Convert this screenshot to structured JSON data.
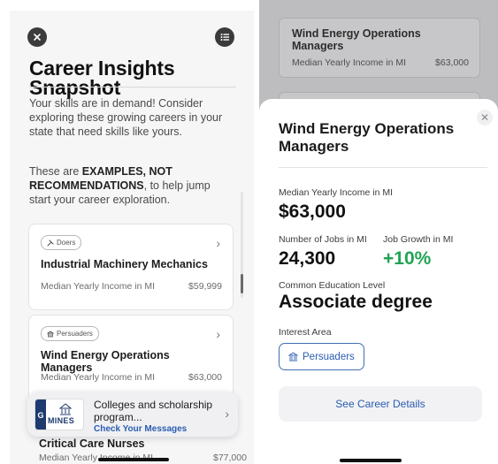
{
  "left": {
    "title_line1": "Career Insights",
    "title_line2": "Snapshot",
    "intro": "Your skills are in demand! Consider exploring these growing careers in your state that need skills like yours.",
    "disclaimer_pre": "These are ",
    "disclaimer_bold": "EXAMPLES, NOT RECOMMENDATIONS",
    "disclaimer_post": ", to help jump start your career exploration.",
    "cards": [
      {
        "tag": "Doers",
        "tag_icon": "tools-icon",
        "title": "Industrial Machinery Mechanics",
        "meta": "Median Yearly Income in MI",
        "value": "$59,999"
      },
      {
        "tag": "Persuaders",
        "tag_icon": "building-icon",
        "title": "Wind Energy Operations Managers",
        "meta": "Median Yearly Income in MI",
        "value": "$63,000"
      }
    ],
    "notification": {
      "title": "Colleges and scholarship program...",
      "subtitle": "Check Your Messages",
      "logo_text": "MINES",
      "logo_side": "G"
    },
    "peek": {
      "title": "Critical Care Nurses",
      "meta": "Median Yearly Income in MI",
      "value": "$77,000"
    }
  },
  "right": {
    "bg_card": {
      "title": "Wind Energy Operations Managers",
      "meta": "Median Yearly Income in MI",
      "value": "$63,000"
    },
    "sheet": {
      "title": "Wind Energy Operations Managers",
      "income_label": "Median Yearly Income in MI",
      "income_value": "$63,000",
      "jobs_label": "Number of Jobs in MI",
      "jobs_value": "24,300",
      "growth_label": "Job Growth in MI",
      "growth_value": "+10%",
      "edu_label": "Common Education Level",
      "edu_value": "Associate degree",
      "interest_label": "Interest Area",
      "interest_value": "Persuaders",
      "details_button": "See Career Details"
    }
  },
  "colors": {
    "accent_blue": "#2a5db0",
    "growth_green": "#21a453",
    "dark_icon": "#3b3b3b"
  }
}
